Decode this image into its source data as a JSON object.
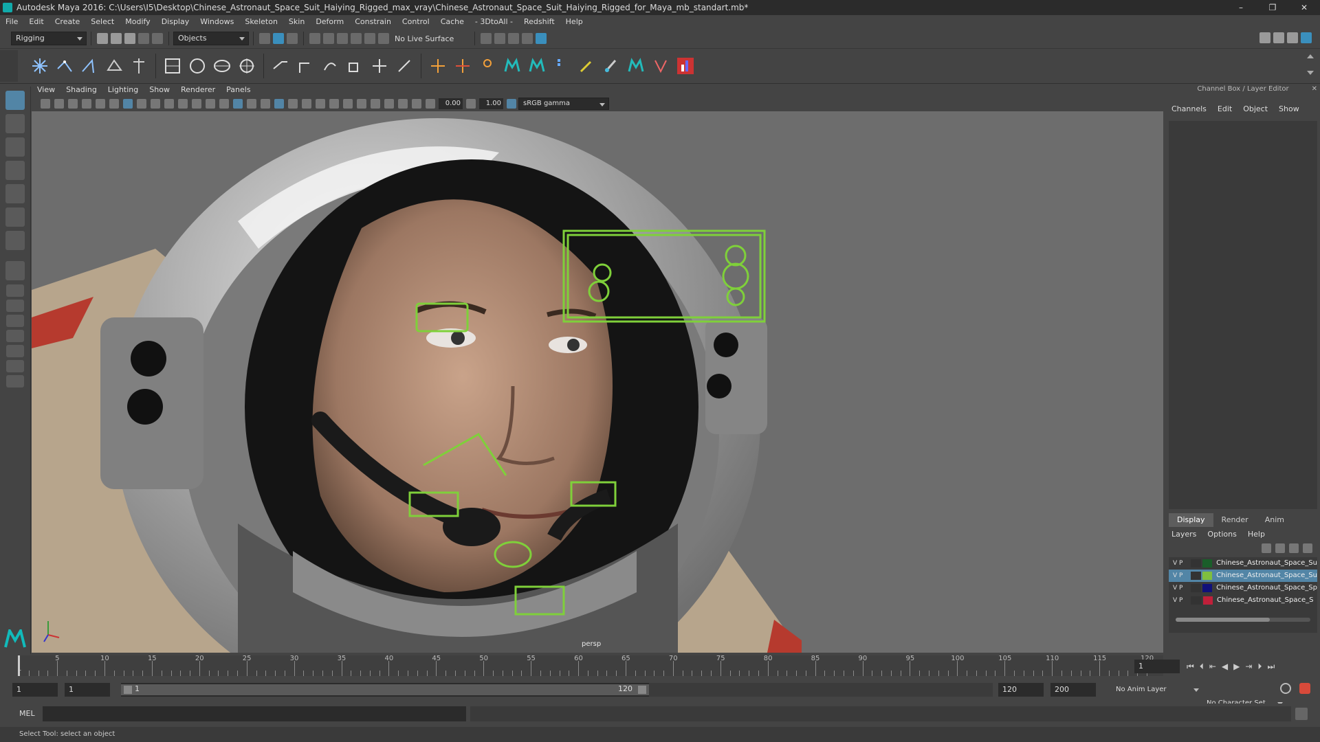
{
  "title_bar": {
    "title": "Autodesk Maya 2016: C:\\Users\\I5\\Desktop\\Chinese_Astronaut_Space_Suit_Haiying_Rigged_max_vray\\Chinese_Astronaut_Space_Suit_Haiying_Rigged_for_Maya_mb_standart.mb*",
    "minimize": "–",
    "maximize": "❐",
    "close": "✕"
  },
  "menu": [
    "File",
    "Edit",
    "Create",
    "Select",
    "Modify",
    "Display",
    "Windows",
    "Skeleton",
    "Skin",
    "Deform",
    "Constrain",
    "Control",
    "Cache",
    "- 3DtoAll -",
    "Redshift",
    "Help"
  ],
  "status_line": {
    "mode": "Rigging",
    "selection_mode": "Objects",
    "live_surface": "No Live Surface"
  },
  "viewport": {
    "menu": [
      "View",
      "Shading",
      "Lighting",
      "Show",
      "Renderer",
      "Panels"
    ],
    "exposure": "0.00",
    "gamma": "1.00",
    "color_space": "sRGB gamma",
    "camera_label": "persp"
  },
  "channel_box": {
    "header": "Channel Box / Layer Editor",
    "menu": [
      "Channels",
      "Edit",
      "Object",
      "Show"
    ],
    "tabs": [
      "Display",
      "Render",
      "Anim"
    ],
    "layer_menu": [
      "Layers",
      "Options",
      "Help"
    ],
    "layers": [
      {
        "v": "V",
        "p": "P",
        "name": "Chinese_Astronaut_Space_Su",
        "color": "#1a5e2a",
        "selected": false
      },
      {
        "v": "V",
        "p": "P",
        "name": "Chinese_Astronaut_Space_Su",
        "color": "#7fbf3f",
        "selected": true
      },
      {
        "v": "V",
        "p": "P",
        "name": "Chinese_Astronaut_Space_Sp",
        "color": "#10107a",
        "selected": false
      },
      {
        "v": "V",
        "p": "P",
        "name": "Chinese_Astronaut_Space_S",
        "color": "#c0203a",
        "selected": false
      }
    ]
  },
  "timeline": {
    "ticks": [
      "1",
      "5",
      "10",
      "15",
      "20",
      "25",
      "30",
      "35",
      "40",
      "45",
      "50",
      "55",
      "60",
      "65",
      "70",
      "75",
      "80",
      "85",
      "90",
      "95",
      "100",
      "105",
      "110",
      "115",
      "120"
    ],
    "current_frame": "1"
  },
  "range": {
    "start": "1",
    "playback_start": "1",
    "slider_start": "1",
    "slider_end": "120",
    "playback_end": "120",
    "end": "200",
    "anim_layer": "No Anim Layer",
    "character_set": "No Character Set"
  },
  "command_line": {
    "label": "MEL"
  },
  "help_line": "Select Tool: select an object",
  "colors": {
    "accent": "#5285a6",
    "rig_green": "#7fd03a"
  }
}
